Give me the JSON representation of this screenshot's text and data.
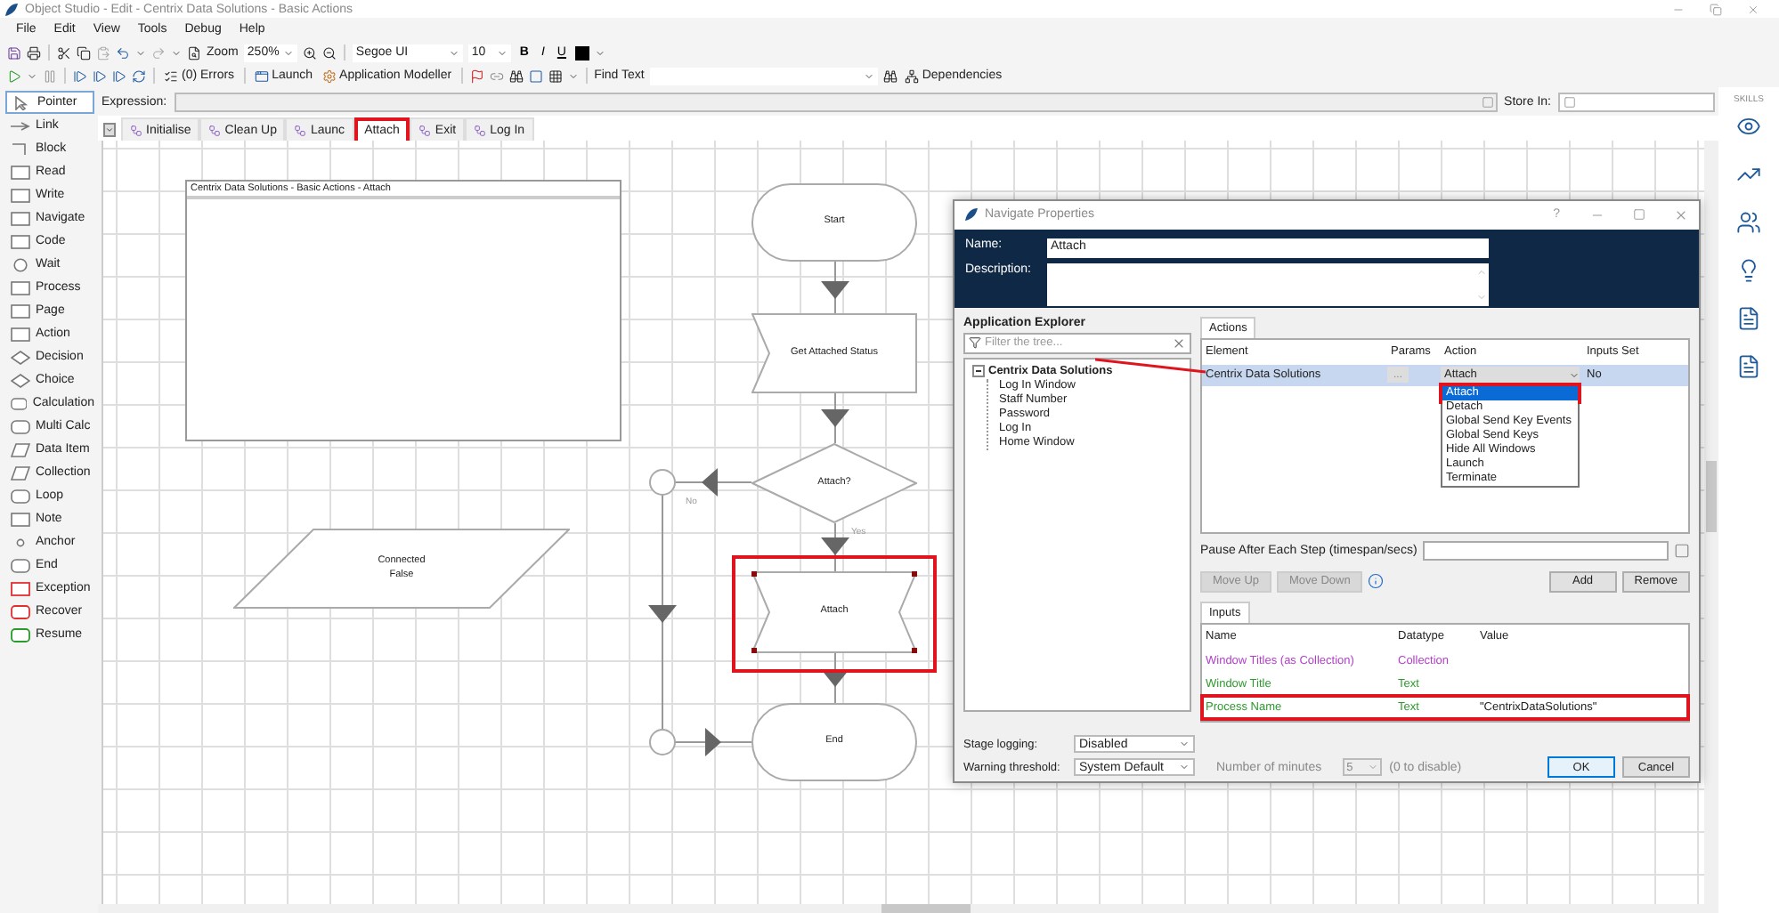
{
  "window": {
    "title": "Object Studio - Edit - Centrix Data Solutions - Basic Actions"
  },
  "menu": [
    "File",
    "Edit",
    "View",
    "Tools",
    "Debug",
    "Help"
  ],
  "toolbar": {
    "zoom_label": "Zoom",
    "zoom": "250%",
    "font": "Segoe UI",
    "font_size": "10",
    "bold": "B",
    "italic": "I",
    "underline": "U",
    "errors": "(0) Errors",
    "launch": "Launch",
    "modeller": "Application Modeller",
    "find_text": "Find Text",
    "dependencies": "Dependencies"
  },
  "palette": [
    {
      "label": "Pointer",
      "kind": "pointer",
      "selected": true
    },
    {
      "label": "Link",
      "kind": "link",
      "selected": false
    },
    {
      "label": "Block",
      "kind": "block",
      "selected": false
    },
    {
      "label": "Read",
      "kind": "stage",
      "selected": false
    },
    {
      "label": "Write",
      "kind": "stage",
      "selected": false
    },
    {
      "label": "Navigate",
      "kind": "stage",
      "selected": false
    },
    {
      "label": "Code",
      "kind": "stage",
      "selected": false
    },
    {
      "label": "Wait",
      "kind": "circle",
      "selected": false
    },
    {
      "label": "Process",
      "kind": "stage",
      "selected": false
    },
    {
      "label": "Page",
      "kind": "stage",
      "selected": false
    },
    {
      "label": "Action",
      "kind": "stage",
      "selected": false
    },
    {
      "label": "Decision",
      "kind": "diamond",
      "selected": false
    },
    {
      "label": "Choice",
      "kind": "diamond",
      "selected": false
    },
    {
      "label": "Calculation",
      "kind": "rounded",
      "selected": false
    },
    {
      "label": "Multi Calc",
      "kind": "rounded",
      "selected": false
    },
    {
      "label": "Data Item",
      "kind": "parallelogram",
      "selected": false
    },
    {
      "label": "Collection",
      "kind": "parallelogram",
      "selected": false
    },
    {
      "label": "Loop",
      "kind": "rounded",
      "selected": false
    },
    {
      "label": "Note",
      "kind": "stage",
      "selected": false
    },
    {
      "label": "Anchor",
      "kind": "dot",
      "selected": false
    },
    {
      "label": "End",
      "kind": "rounded",
      "selected": false
    },
    {
      "label": "Exception",
      "kind": "exception",
      "selected": false
    },
    {
      "label": "Recover",
      "kind": "recover",
      "selected": false
    },
    {
      "label": "Resume",
      "kind": "resume",
      "selected": false
    }
  ],
  "expression": {
    "label": "Expression:"
  },
  "store_in": {
    "label": "Store In:"
  },
  "skills": {
    "label": "SKILLS"
  },
  "tabs": [
    {
      "label": "Initialise",
      "selected": false,
      "highlighted": false
    },
    {
      "label": "Clean Up",
      "selected": false,
      "highlighted": false
    },
    {
      "label": "Launc",
      "selected": false,
      "highlighted": false
    },
    {
      "label": "Attach",
      "selected": true,
      "highlighted": true
    },
    {
      "label": "Exit",
      "selected": false,
      "highlighted": false
    },
    {
      "label": "Log In",
      "selected": false,
      "highlighted": false
    }
  ],
  "canvas": {
    "page_info": "Centrix Data Solutions - Basic Actions - Attach",
    "nodes": [
      {
        "kind": "terminator",
        "label": "Start",
        "selected": false,
        "highlighted": false
      },
      {
        "kind": "read",
        "label": "Get Attached Status",
        "selected": false,
        "highlighted": false
      },
      {
        "kind": "decision",
        "label": "Attach?",
        "selected": false,
        "highlighted": false
      },
      {
        "kind": "navigate",
        "label": "Attach",
        "selected": true,
        "highlighted": true
      },
      {
        "kind": "terminator",
        "label": "End",
        "selected": false,
        "highlighted": false
      },
      {
        "kind": "data",
        "label": "Connected\nFalse",
        "selected": false,
        "highlighted": false
      }
    ],
    "labels": [
      "No",
      "Yes"
    ]
  },
  "dialog": {
    "title": "Navigate Properties",
    "help": "?",
    "name_label": "Name:",
    "name": "Attach",
    "description_label": "Description:",
    "explorer": {
      "title": "Application Explorer",
      "filter_placeholder": "Filter the tree...",
      "tree": [
        {
          "label": "Centrix Data Solutions",
          "expanded": true,
          "children": [
            {
              "label": "Log In Window"
            },
            {
              "label": "Staff Number"
            },
            {
              "label": "Password"
            },
            {
              "label": "Log In"
            },
            {
              "label": "Home Window"
            }
          ]
        }
      ]
    },
    "actions": {
      "tab": "Actions",
      "columns": [
        "Element",
        "Params",
        "Action",
        "Inputs Set"
      ],
      "rows": [
        {
          "element": "Centrix Data Solutions",
          "params": "...",
          "action": "Attach",
          "inputs_set": "No",
          "selected": true
        }
      ],
      "dropdown": {
        "expanded": true,
        "options": [
          {
            "label": "Attach",
            "selected": true,
            "highlighted": true
          },
          {
            "label": "Detach",
            "selected": false,
            "highlighted": false
          },
          {
            "label": "Global Send Key Events",
            "selected": false,
            "highlighted": false
          },
          {
            "label": "Global Send Keys",
            "selected": false,
            "highlighted": false
          },
          {
            "label": "Hide All Windows",
            "selected": false,
            "highlighted": false
          },
          {
            "label": "Launch",
            "selected": false,
            "highlighted": false
          },
          {
            "label": "Terminate",
            "selected": false,
            "highlighted": false
          }
        ]
      }
    },
    "pause_label": "Pause After Each Step (timespan/secs)",
    "buttons": [
      {
        "label": "Move Up",
        "disabled": true
      },
      {
        "label": "Move Down",
        "disabled": true
      },
      {
        "label": "Add",
        "disabled": false
      },
      {
        "label": "Remove",
        "disabled": false
      }
    ],
    "inputs": {
      "tab": "Inputs",
      "columns": [
        "Name",
        "Datatype",
        "Value"
      ],
      "rows": [
        {
          "name": "Window Titles (as Collection)",
          "datatype": "Collection",
          "color": "#b040c8",
          "highlighted": false
        },
        {
          "name": "Window Title",
          "datatype": "Text",
          "color": "#2e9a2e",
          "highlighted": false
        },
        {
          "name": "Process Name",
          "datatype": "Text",
          "value": "\"CentrixDataSolutions\"",
          "color": "#2e9a2e",
          "highlighted": true
        }
      ]
    },
    "stage_logging": {
      "label": "Stage logging:",
      "value": "Disabled"
    },
    "warning": {
      "label": "Warning threshold:",
      "value": "System Default",
      "minutes_label": "Number of minutes",
      "minutes": "5",
      "hint": "(0 to disable)"
    },
    "ok": "OK",
    "cancel": "Cancel"
  }
}
